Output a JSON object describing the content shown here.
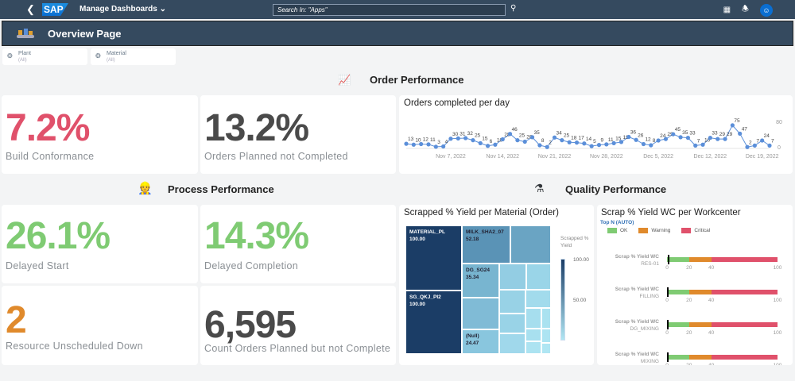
{
  "shell": {
    "back_icon": "chevron-left-icon",
    "logo": "SAP",
    "app_title": "Manage Dashboards",
    "search_placeholder": "Search In: \"Apps\"",
    "icons": [
      "search-icon",
      "insights-icon",
      "bell-icon",
      "user-avatar-icon"
    ]
  },
  "header": {
    "title": "Overview Page"
  },
  "filters": [
    {
      "label": "Plant",
      "value": "(All)"
    },
    {
      "label": "Material",
      "value": "(All)"
    }
  ],
  "sections": {
    "order": "Order Performance",
    "process": "Process Performance",
    "quality": "Quality Performance"
  },
  "kpis": {
    "build_conformance": {
      "value": "7.2%",
      "label": "Build Conformance",
      "color": "#e0516b"
    },
    "orders_planned_not_completed": {
      "value": "13.2%",
      "label": "Orders Planned not Completed",
      "color": "#4a4a4a"
    },
    "delayed_start": {
      "value": "26.1%",
      "label": "Delayed Start",
      "color": "#7fcb73"
    },
    "delayed_completion": {
      "value": "14.3%",
      "label": "Delayed Completion",
      "color": "#7fcb73"
    },
    "resource_unscheduled_down": {
      "value": "2",
      "label": "Resource Unscheduled Down",
      "color": "#e08a2c"
    },
    "count_orders": {
      "value": "6,595",
      "label": "Count Orders Planned but not Complete",
      "color": "#4a4a4a"
    }
  },
  "chart_data": [
    {
      "type": "line",
      "title": "Orders completed per day",
      "ylim": [
        0,
        80
      ],
      "yticks": [
        "0",
        "80"
      ],
      "x": [
        "2022-11-01",
        "2022-11-02",
        "2022-11-03",
        "2022-11-04",
        "2022-11-05",
        "2022-11-06",
        "2022-11-07",
        "2022-11-08",
        "2022-11-09",
        "2022-11-10",
        "2022-11-11",
        "2022-11-12",
        "2022-11-13",
        "2022-11-14",
        "2022-11-15",
        "2022-11-16",
        "2022-11-17",
        "2022-11-18",
        "2022-11-19",
        "2022-11-20",
        "2022-11-21",
        "2022-11-22",
        "2022-11-23",
        "2022-11-24",
        "2022-11-25",
        "2022-11-26",
        "2022-11-27",
        "2022-11-28",
        "2022-11-29",
        "2022-11-30",
        "2022-12-01",
        "2022-12-02",
        "2022-12-03",
        "2022-12-04",
        "2022-12-05",
        "2022-12-06",
        "2022-12-07",
        "2022-12-08",
        "2022-12-09",
        "2022-12-10",
        "2022-12-11",
        "2022-12-12",
        "2022-12-13",
        "2022-12-14",
        "2022-12-15",
        "2022-12-16",
        "2022-12-17",
        "2022-12-18",
        "2022-12-19",
        "2022-12-20"
      ],
      "values": [
        13,
        10,
        12,
        11,
        3,
        4,
        30,
        31,
        32,
        25,
        15,
        6,
        10,
        28,
        46,
        25,
        20,
        35,
        8,
        2,
        34,
        25,
        18,
        17,
        14,
        5,
        9,
        11,
        15,
        19,
        36,
        26,
        12,
        8,
        24,
        29,
        45,
        35,
        33,
        7,
        10,
        33,
        29,
        29,
        75,
        47,
        2,
        7,
        24,
        7
      ],
      "xtick_labels": [
        {
          "index": 6,
          "label": "Nov 7, 2022"
        },
        {
          "index": 13,
          "label": "Nov 14, 2022"
        },
        {
          "index": 20,
          "label": "Nov 21, 2022"
        },
        {
          "index": 27,
          "label": "Nov 28, 2022"
        },
        {
          "index": 34,
          "label": "Dec 5, 2022"
        },
        {
          "index": 41,
          "label": "Dec 12, 2022"
        },
        {
          "index": 48,
          "label": "Dec 19, 2022"
        }
      ],
      "color": "#5b8fd9"
    },
    {
      "type": "treemap",
      "title": "Scrapped % Yield per Material (Order)",
      "legend_title": "Scrapped % Yield",
      "legend_ticks": [
        "100.00",
        "50.00"
      ],
      "items": [
        {
          "label": "MATERIAL_PL",
          "value": "100.00"
        },
        {
          "label": "SG_QKJ_PI2",
          "value": "100.00"
        },
        {
          "label": "MILK_SHA2_07",
          "value": "52.18"
        },
        {
          "label": "DG_SG24",
          "value": "35.34"
        },
        {
          "label": "(Null)",
          "value": "24.47"
        }
      ]
    },
    {
      "type": "bullet",
      "title": "Scrap % Yield WC per Workcenter",
      "subtitle": "Top N (AUTO)",
      "legend": [
        {
          "label": "OK",
          "color": "#7fcb73"
        },
        {
          "label": "Warning",
          "color": "#e08a2c"
        },
        {
          "label": "Critical",
          "color": "#e0516b"
        }
      ],
      "ticks": [
        "0",
        "20",
        "40",
        "100"
      ],
      "thresholds": [
        0,
        20,
        40,
        100
      ],
      "rows": [
        {
          "measure": "Scrap % Yield WC",
          "name": "RES-01",
          "value": 1
        },
        {
          "measure": "Scrap % Yield WC",
          "name": "FILLING",
          "value": 0
        },
        {
          "measure": "Scrap % Yield WC",
          "name": "DG_MIXING",
          "value": 0
        },
        {
          "measure": "Scrap % Yield WC",
          "name": "MIXING",
          "value": 0
        }
      ]
    }
  ]
}
